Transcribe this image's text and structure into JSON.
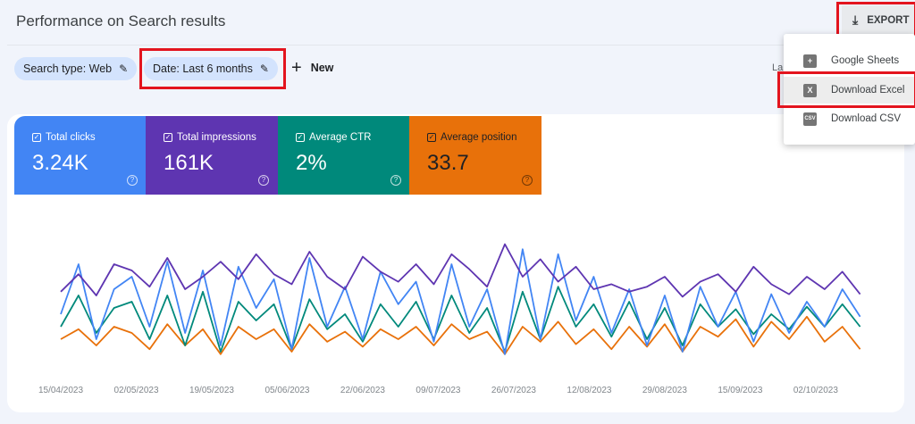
{
  "header": {
    "title": "Performance on Search results",
    "export_label": "EXPORT"
  },
  "filters": {
    "chips": [
      {
        "label": "Search type: Web"
      },
      {
        "label": "Date: Last 6 months"
      }
    ],
    "new_label": "New",
    "truncated_text": "La"
  },
  "export_menu": {
    "items": [
      {
        "label": "Google Sheets",
        "icon": "sheets-icon",
        "glyph": "+"
      },
      {
        "label": "Download Excel",
        "icon": "excel-icon",
        "glyph": "X"
      },
      {
        "label": "Download CSV",
        "icon": "csv-icon",
        "glyph": "CSV"
      }
    ]
  },
  "metrics": [
    {
      "label": "Total clicks",
      "value": "3.24K",
      "color": "#4285f4",
      "checked": true
    },
    {
      "label": "Total impressions",
      "value": "161K",
      "color": "#5e35b1",
      "checked": true
    },
    {
      "label": "Average CTR",
      "value": "2%",
      "color": "#00897b",
      "checked": true
    },
    {
      "label": "Average position",
      "value": "33.7",
      "color": "#e8710a",
      "checked": true
    }
  ],
  "chart_data": {
    "type": "line",
    "ticks": [
      "15/04/2023",
      "02/05/2023",
      "19/05/2023",
      "05/06/2023",
      "22/06/2023",
      "09/07/2023",
      "26/07/2023",
      "12/08/2023",
      "29/08/2023",
      "15/09/2023",
      "02/10/2023"
    ],
    "x": [
      "15/04/2023",
      "19/04/2023",
      "23/04/2023",
      "27/04/2023",
      "01/05/2023",
      "05/05/2023",
      "09/05/2023",
      "13/05/2023",
      "17/05/2023",
      "21/05/2023",
      "25/05/2023",
      "29/05/2023",
      "02/06/2023",
      "06/06/2023",
      "10/06/2023",
      "14/06/2023",
      "18/06/2023",
      "22/06/2023",
      "26/06/2023",
      "30/06/2023",
      "04/07/2023",
      "08/07/2023",
      "12/07/2023",
      "16/07/2023",
      "20/07/2023",
      "24/07/2023",
      "28/07/2023",
      "01/08/2023",
      "05/08/2023",
      "09/08/2023",
      "13/08/2023",
      "17/08/2023",
      "21/08/2023",
      "25/08/2023",
      "29/08/2023",
      "02/09/2023",
      "06/09/2023",
      "10/09/2023",
      "14/09/2023",
      "18/09/2023",
      "22/09/2023",
      "26/09/2023",
      "30/09/2023",
      "04/10/2023",
      "08/10/2023",
      "12/10/2023"
    ],
    "y_axis_shown": false,
    "grid": false,
    "series": [
      {
        "metric": "Total impressions",
        "color": "#5e35b1",
        "values": [
          58,
          72,
          55,
          80,
          75,
          62,
          85,
          60,
          70,
          82,
          68,
          88,
          72,
          64,
          90,
          70,
          60,
          86,
          74,
          66,
          80,
          64,
          88,
          76,
          62,
          96,
          70,
          84,
          66,
          78,
          60,
          64,
          58,
          62,
          70,
          54,
          66,
          72,
          58,
          78,
          64,
          56,
          70,
          60,
          74,
          56
        ]
      },
      {
        "metric": "Total clicks",
        "color": "#4285f4",
        "values": [
          40,
          80,
          20,
          60,
          70,
          30,
          82,
          25,
          75,
          15,
          78,
          45,
          68,
          12,
          85,
          30,
          62,
          20,
          74,
          48,
          66,
          18,
          80,
          30,
          60,
          8,
          92,
          20,
          88,
          35,
          70,
          25,
          60,
          15,
          55,
          10,
          62,
          30,
          58,
          18,
          56,
          25,
          50,
          30,
          60,
          38
        ]
      },
      {
        "metric": "Average CTR",
        "color": "#00897b",
        "values": [
          30,
          55,
          25,
          45,
          50,
          20,
          55,
          15,
          58,
          10,
          50,
          35,
          48,
          12,
          52,
          28,
          40,
          18,
          48,
          30,
          50,
          20,
          55,
          25,
          45,
          10,
          58,
          20,
          62,
          30,
          48,
          22,
          50,
          20,
          45,
          15,
          48,
          30,
          44,
          24,
          40,
          28,
          46,
          30,
          48,
          30
        ]
      },
      {
        "metric": "Average position",
        "color": "#e8710a",
        "values": [
          20,
          28,
          15,
          30,
          25,
          12,
          32,
          15,
          28,
          8,
          30,
          20,
          28,
          10,
          32,
          18,
          26,
          14,
          28,
          20,
          30,
          15,
          32,
          20,
          26,
          8,
          30,
          18,
          34,
          16,
          28,
          12,
          30,
          14,
          32,
          10,
          30,
          22,
          36,
          14,
          34,
          20,
          38,
          18,
          30,
          12
        ]
      }
    ]
  }
}
